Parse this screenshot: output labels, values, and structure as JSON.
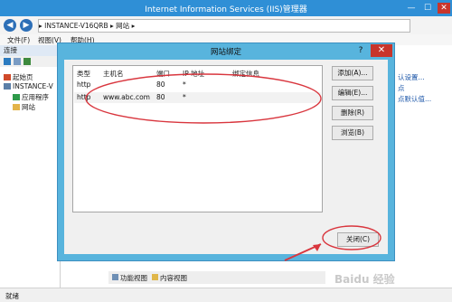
{
  "window": {
    "title": "Internet Information Services (IIS)管理器",
    "min": "—",
    "max": "☐",
    "close": "✕"
  },
  "address": {
    "back": "◀",
    "forward": "▶",
    "path": "▸  INSTANCE-V16QRB  ▸  网站  ▸"
  },
  "menu": [
    "文件(F)",
    "视图(V)",
    "帮助(H)"
  ],
  "connections": {
    "header": "连接",
    "tree": [
      "起始页",
      "INSTANCE-V",
      "应用程序",
      "网站"
    ]
  },
  "actions": {
    "links": [
      "认设置...",
      "点",
      "点默认值..."
    ]
  },
  "view_tabs": [
    "功能视图",
    "内容视图"
  ],
  "status": "就绪",
  "dialog": {
    "title": "网站绑定",
    "help": "?",
    "close": "✕",
    "columns": [
      "类型",
      "主机名",
      "端口",
      "IP 地址",
      "绑定信息"
    ],
    "rows": [
      {
        "type": "http",
        "host": "",
        "port": "80",
        "ip": "*",
        "info": ""
      },
      {
        "type": "http",
        "host": "www.abc.com",
        "port": "80",
        "ip": "*",
        "info": ""
      }
    ],
    "buttons": {
      "add": "添加(A)...",
      "edit": "编辑(E)...",
      "remove": "删除(R)",
      "browse": "浏览(B)",
      "close": "关闭(C)"
    }
  },
  "watermark": "Baidu 经验",
  "colors": {
    "titlebar": "#2f8fd6",
    "dialog_frame": "#58b4dd",
    "annotation": "#d9363e"
  }
}
